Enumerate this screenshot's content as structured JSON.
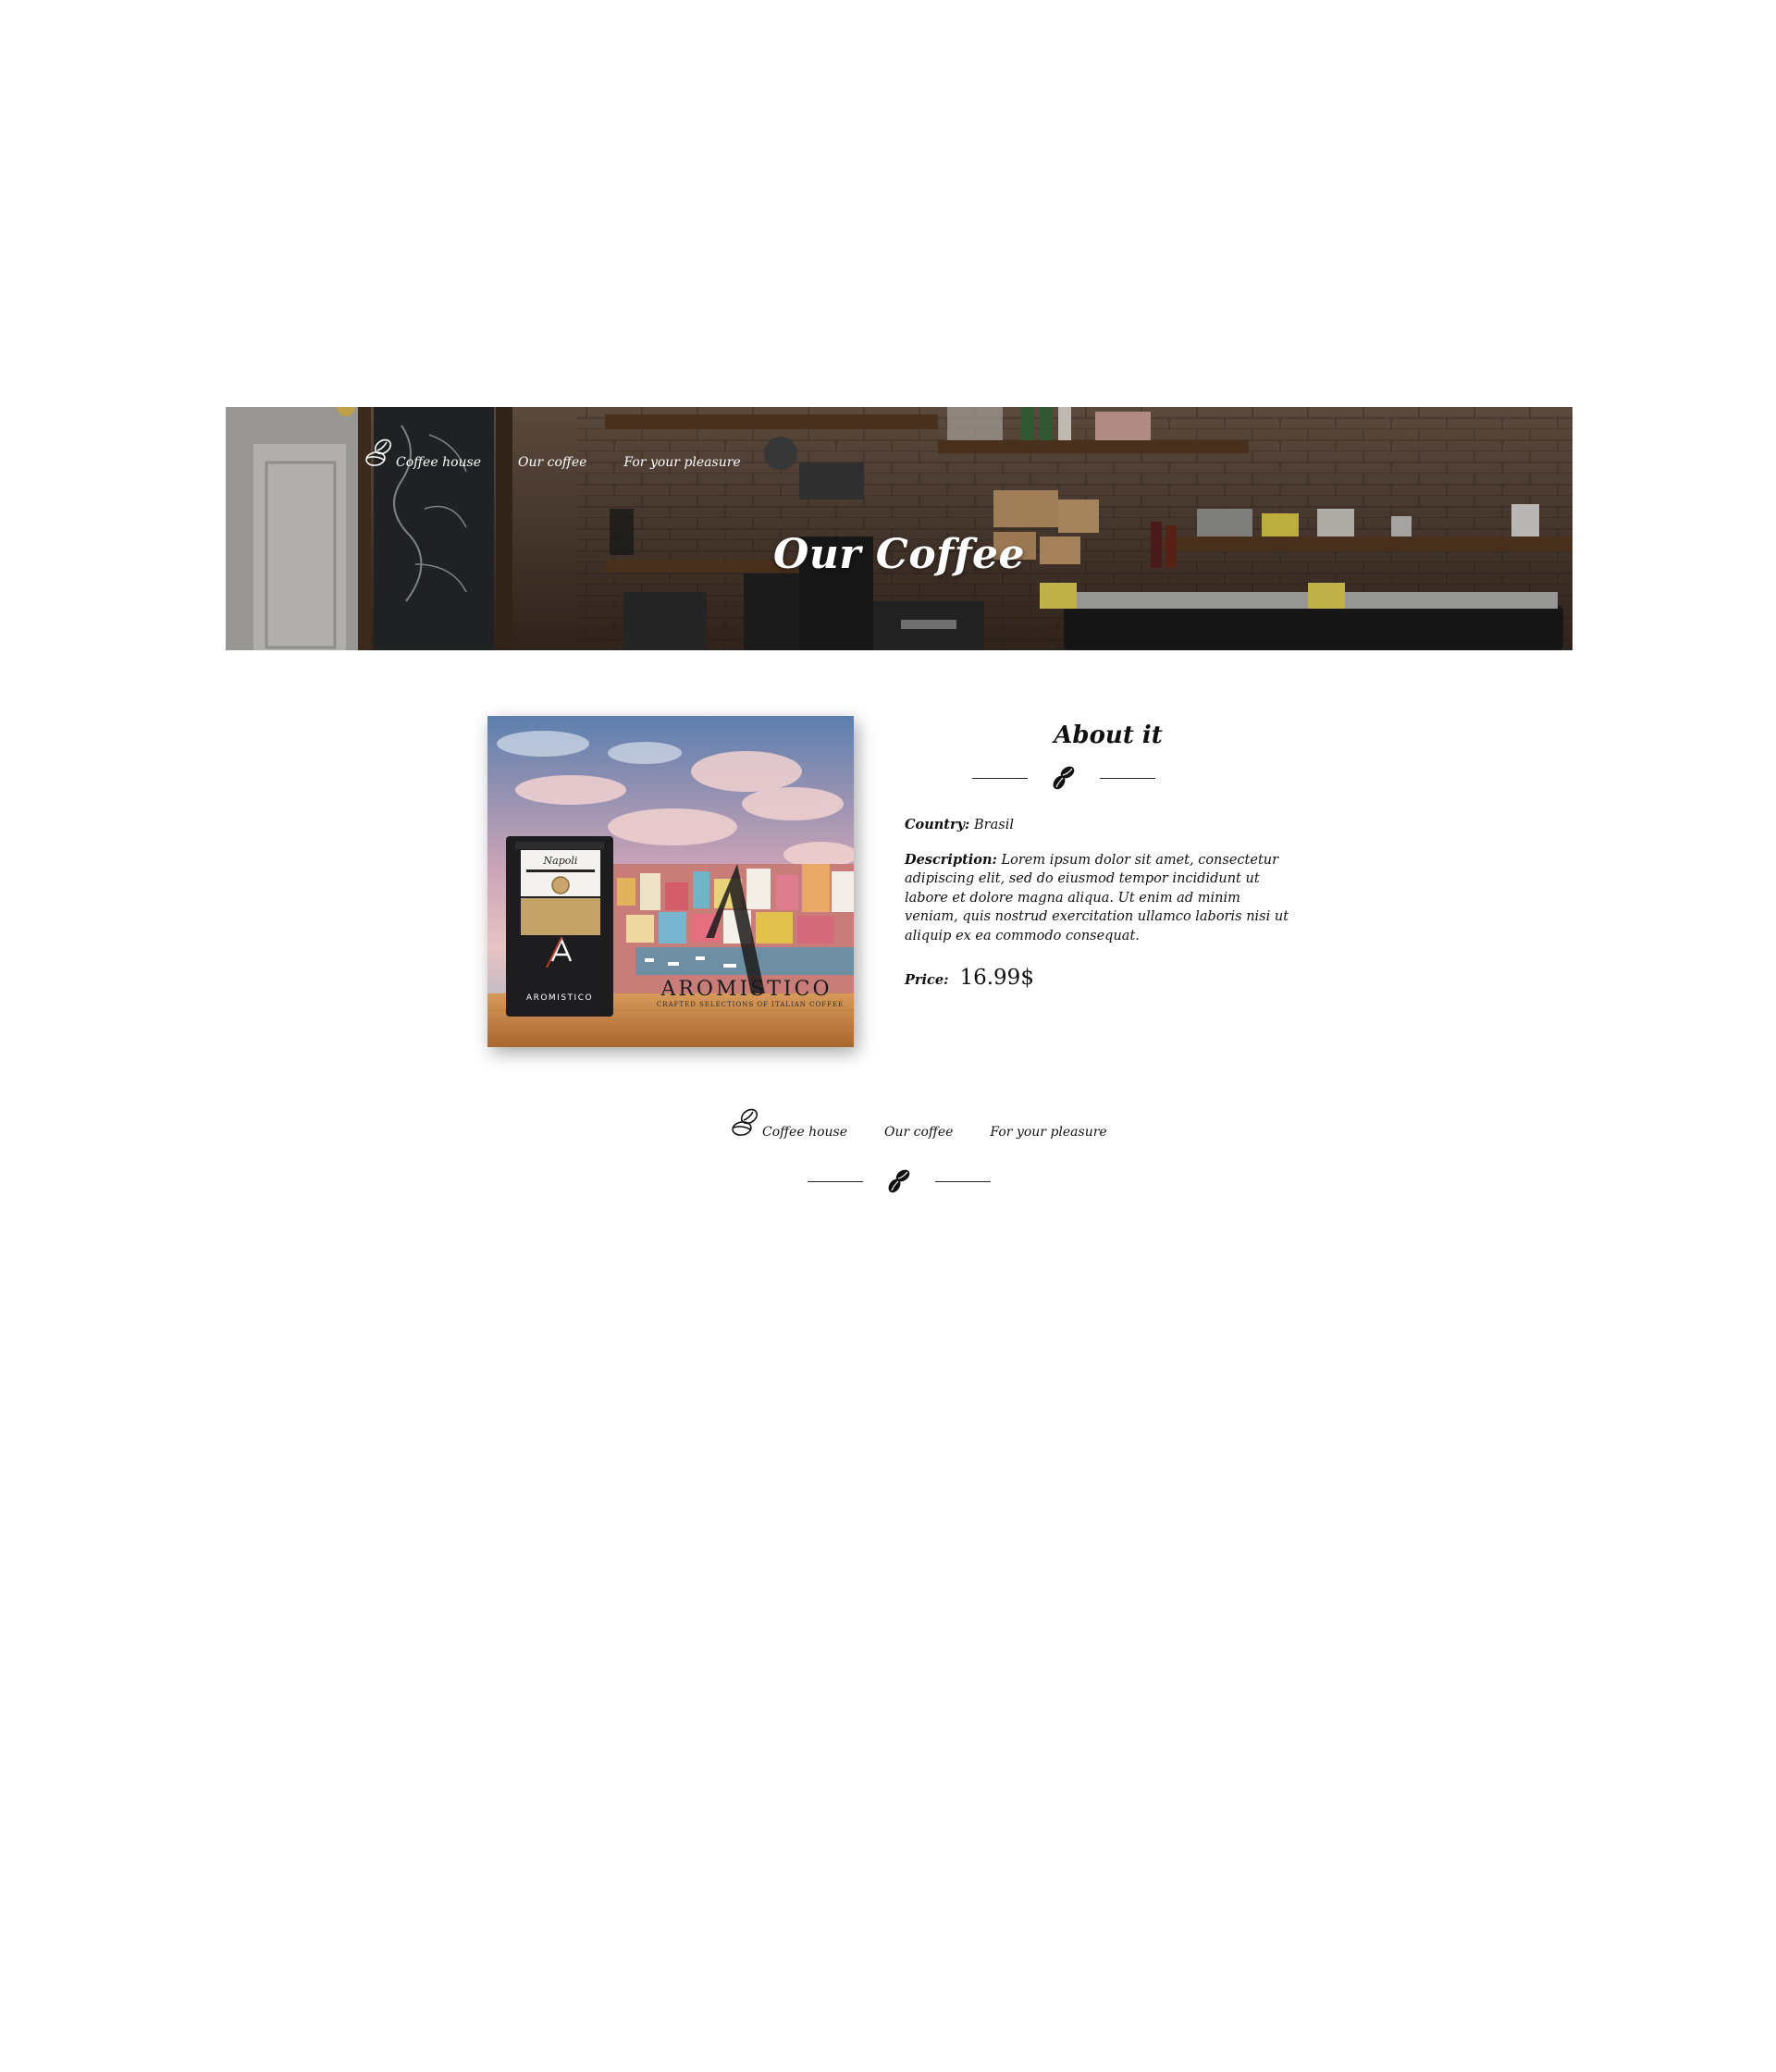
{
  "header": {
    "nav": {
      "logo_label": "Coffee house",
      "links": [
        "Our coffee",
        "For your pleasure"
      ]
    },
    "title": "Our Coffee"
  },
  "product": {
    "image": {
      "brand": "AROMISTICO",
      "tagline": "CRAFTED SELECTIONS OF ITALIAN COFFEE",
      "package_name": "Napoli"
    },
    "about": {
      "title": "About it",
      "country_label": "Country:",
      "country_value": "Brasil",
      "description_label": "Description:",
      "description_value": "Lorem ipsum dolor sit amet, consectetur adipiscing elit, sed do eiusmod tempor incididunt ut labore et dolore magna aliqua. Ut enim ad minim veniam, quis nostrud exercitation ullamco laboris nisi ut aliquip ex ea commodo consequat.",
      "price_label": "Price:",
      "price_value": "16.99$"
    }
  },
  "footer": {
    "nav": {
      "logo_label": "Coffee house",
      "links": [
        "Our coffee",
        "For your pleasure"
      ]
    }
  },
  "icons": {
    "logo": "coffee-beans-outline-icon",
    "divider": "coffee-beans-icon"
  },
  "colors": {
    "text": "#111111",
    "hero_text": "#ffffff",
    "background": "#ffffff"
  }
}
